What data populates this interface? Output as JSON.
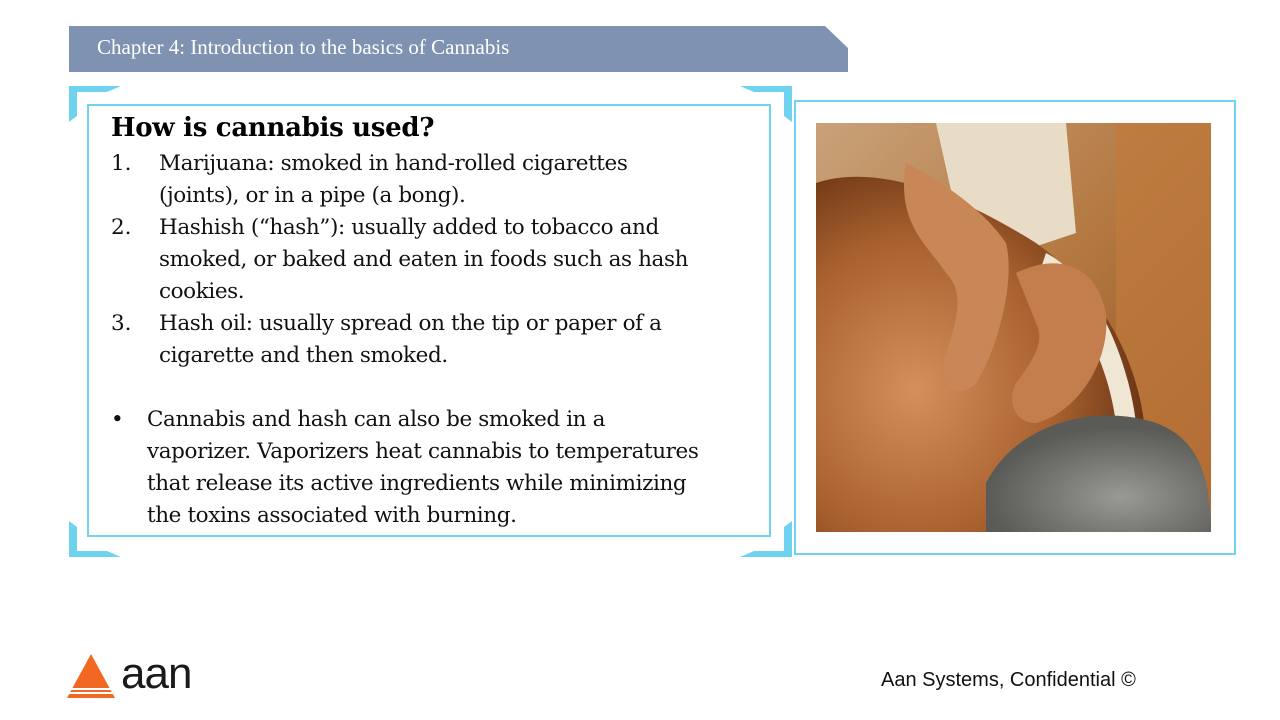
{
  "header": {
    "title": "Chapter 4: Introduction to the basics of Cannabis"
  },
  "content": {
    "heading": "How is cannabis used?",
    "numbered_items": [
      {
        "number": "1.",
        "lines": [
          "Marijuana: smoked in hand-rolled cigarettes",
          "(joints), or in a pipe (a bong)."
        ]
      },
      {
        "number": "2.",
        "lines": [
          "Hashish (“hash”): usually added to tobacco and",
          "smoked, or baked and eaten in foods such as hash",
          "cookies."
        ]
      },
      {
        "number": "3.",
        "lines": [
          "Hash oil: usually spread on the tip or paper of a",
          "cigarette and then smoked."
        ]
      }
    ],
    "bullet": {
      "symbol": "•",
      "lines": [
        "Cannabis and hash can also be smoked in a",
        "vaporizer.  Vaporizers heat cannabis to temperatures",
        "that release its active ingredients while minimizing",
        "the toxins associated with burning."
      ]
    }
  },
  "image": {
    "subject": "massage-photo-icon"
  },
  "footer": {
    "logo_text": "aan",
    "confidential": "Aan Systems, Confidential ©"
  },
  "colors": {
    "banner": "#7f92b1",
    "frame": "#6fd3f0",
    "logo_orange": "#f26722"
  }
}
